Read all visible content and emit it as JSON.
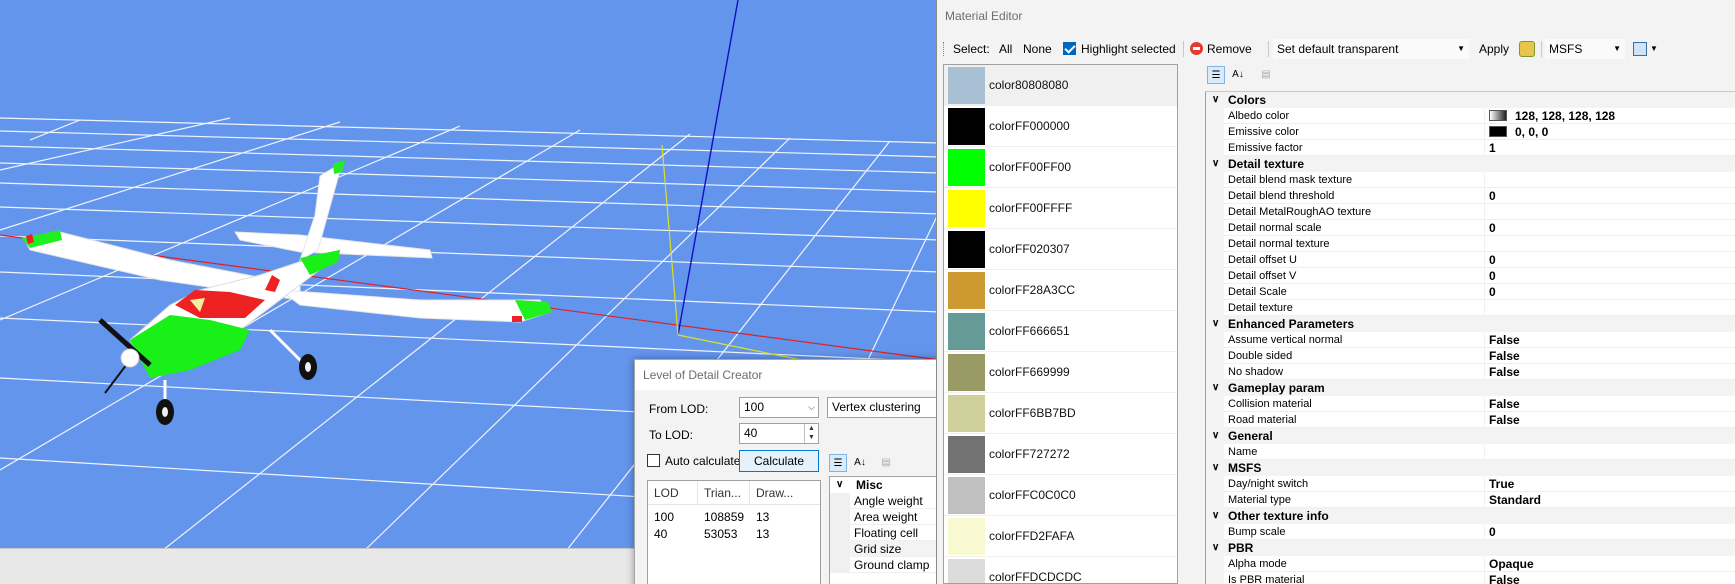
{
  "lod_window": {
    "title": "Level of Detail Creator",
    "from_label": "From LOD:",
    "from_value": "100",
    "to_label": "To LOD:",
    "to_value": "40",
    "method": "Vertex clustering",
    "auto_label": "Auto calculate",
    "calculate_label": "Calculate",
    "columns": [
      "LOD",
      "Trian...",
      "Draw..."
    ],
    "rows": [
      [
        "100",
        "108859",
        "13"
      ],
      [
        "40",
        "53053",
        "13"
      ]
    ],
    "grid_category": "Misc",
    "grid_items": [
      "Angle weight",
      "Area weight",
      "Floating cell",
      "Grid size",
      "Ground clamp"
    ]
  },
  "material_editor": {
    "title": "Material Editor",
    "toolbar": {
      "select_label": "Select:",
      "all_label": "All",
      "none_label": "None",
      "highlight_label": "Highlight selected",
      "remove_label": "Remove",
      "default_combo": "Set default transparent",
      "apply_label": "Apply",
      "platform_combo": "MSFS"
    },
    "materials": [
      {
        "name": "color80808080",
        "color": "#a8bfd4"
      },
      {
        "name": "colorFF000000",
        "color": "#000000"
      },
      {
        "name": "colorFF00FF00",
        "color": "#00ff00"
      },
      {
        "name": "colorFF00FFFF",
        "color": "#ffff00"
      },
      {
        "name": "colorFF020307",
        "color": "#000000"
      },
      {
        "name": "colorFF28A3CC",
        "color": "#cc9a30"
      },
      {
        "name": "colorFF666651",
        "color": "#669a96"
      },
      {
        "name": "colorFF669999",
        "color": "#9a9a66"
      },
      {
        "name": "colorFF6BB7BD",
        "color": "#cfcf9c"
      },
      {
        "name": "colorFF727272",
        "color": "#727272"
      },
      {
        "name": "colorFFC0C0C0",
        "color": "#c0c0c0"
      },
      {
        "name": "colorFFD2FAFA",
        "color": "#fafad2"
      },
      {
        "name": "colorFFDCDCDC",
        "color": "#dcdcdc"
      }
    ],
    "properties": [
      {
        "category": "Colors",
        "items": [
          {
            "key": "Albedo color",
            "value": "128, 128, 128, 128",
            "swatch": "albedo"
          },
          {
            "key": "Emissive color",
            "value": "0, 0, 0",
            "swatch": "black"
          },
          {
            "key": "Emissive factor",
            "value": "1"
          }
        ]
      },
      {
        "category": "Detail texture",
        "items": [
          {
            "key": "Detail blend mask texture",
            "value": ""
          },
          {
            "key": "Detail blend threshold",
            "value": "0"
          },
          {
            "key": "Detail MetalRoughAO texture",
            "value": ""
          },
          {
            "key": "Detail normal scale",
            "value": "0"
          },
          {
            "key": "Detail normal texture",
            "value": ""
          },
          {
            "key": "Detail offset U",
            "value": "0"
          },
          {
            "key": "Detail offset V",
            "value": "0"
          },
          {
            "key": "Detail Scale",
            "value": "0"
          },
          {
            "key": "Detail texture",
            "value": ""
          }
        ]
      },
      {
        "category": "Enhanced Parameters",
        "items": [
          {
            "key": "Assume vertical normal",
            "value": "False"
          },
          {
            "key": "Double sided",
            "value": "False"
          },
          {
            "key": "No shadow",
            "value": "False"
          }
        ]
      },
      {
        "category": "Gameplay param",
        "items": [
          {
            "key": "Collision material",
            "value": "False"
          },
          {
            "key": "Road material",
            "value": "False"
          }
        ]
      },
      {
        "category": "General",
        "items": [
          {
            "key": "Name",
            "value": ""
          }
        ]
      },
      {
        "category": "MSFS",
        "items": [
          {
            "key": "Day/night switch",
            "value": "True"
          },
          {
            "key": "Material type",
            "value": "Standard"
          }
        ]
      },
      {
        "category": "Other texture info",
        "items": [
          {
            "key": "Bump scale",
            "value": "0"
          }
        ]
      },
      {
        "category": "PBR",
        "items": [
          {
            "key": "Alpha mode",
            "value": "Opaque"
          },
          {
            "key": "Is PBR material",
            "value": "False"
          }
        ]
      }
    ]
  },
  "colors": {
    "viewport_bg": "#6495ed",
    "accent": "#0078d7"
  }
}
